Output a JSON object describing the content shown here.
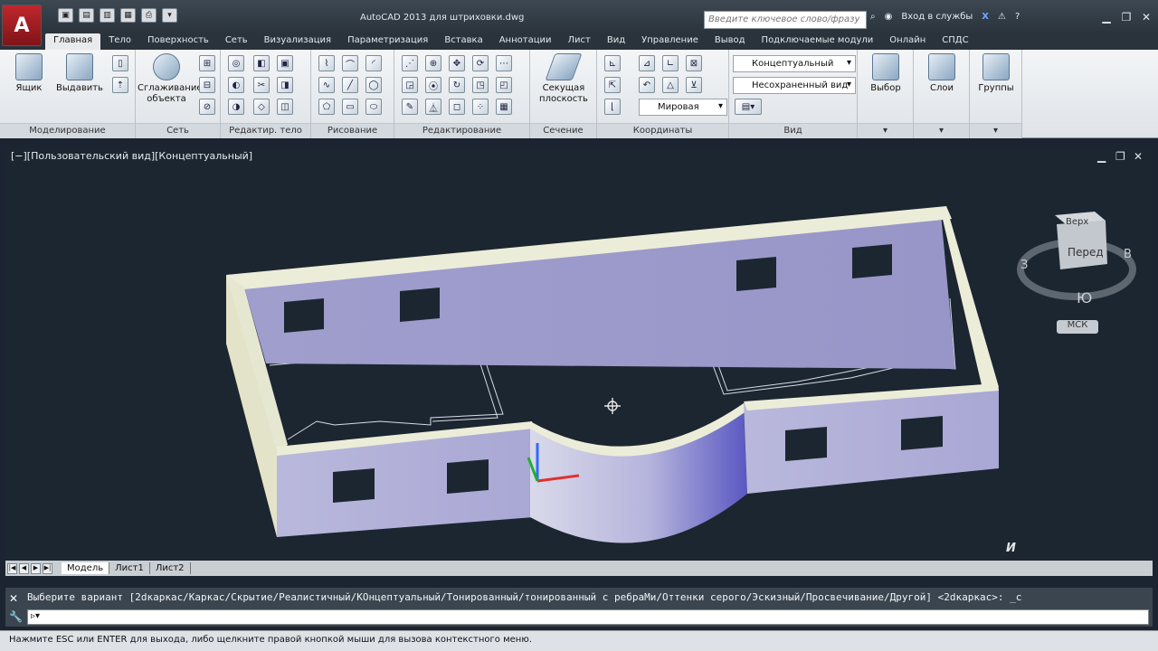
{
  "app": {
    "button_label": "A",
    "window_title": "AutoCAD 2013    для штриховки.dwg",
    "search_placeholder": "Введите ключевое слово/фразу",
    "login_label": "Вход в службы"
  },
  "qat_icons": [
    "save-icon",
    "saveas-icon",
    "open-icon",
    "new-icon",
    "print-icon",
    "more-icon"
  ],
  "tabs": [
    "Главная",
    "Тело",
    "Поверхность",
    "Сеть",
    "Визуализация",
    "Параметризация",
    "Вставка",
    "Аннотации",
    "Лист",
    "Вид",
    "Управление",
    "Вывод",
    "Подключаемые модули",
    "Онлайн",
    "СПДС"
  ],
  "ribbon": {
    "box_label": "Ящик",
    "extrude_label": "Выдавить",
    "smooth_label_1": "Сглаживание",
    "smooth_label_2": "объекта",
    "section_label_1": "Секущая",
    "section_label_2": "плоскость",
    "select_label": "Выбор",
    "layers_label": "Слои",
    "groups_label": "Группы",
    "visual_style": "Концептуальный",
    "named_view": "Несохраненный вид",
    "coords_world": "Мировая",
    "panels": {
      "modeling": "Моделирование",
      "mesh": "Сеть",
      "solid_edit": "Редактир. тело",
      "draw": "Рисование",
      "modify": "Редактирование",
      "section": "Сечение",
      "coordinates": "Координаты",
      "view": "Вид"
    }
  },
  "viewport": {
    "title": "[−][Пользовательский вид][Концептуальный]",
    "viewcube": {
      "top": "Верх",
      "front": "Перед",
      "west": "З",
      "east": "В",
      "south": "Ю",
      "ucs": "МСК"
    }
  },
  "layout_tabs": [
    "Модель",
    "Лист1",
    "Лист2"
  ],
  "command": {
    "history": "Выберите вариант [2dкаркас/Каркас/Скрытие/Реалистичный/КОнцептуальный/Тонированный/тонированный с ребраМи/Оттенки серого/Эскизный/Просвечивание/Другой] <2dкаркас>: _c",
    "prompt": ""
  },
  "status_text": "Нажмите ESC или ENTER для выхода, либо щелкните правой кнопкой мыши для вызова контекстного меню.",
  "colors": {
    "viewport_bg": "#1c2631",
    "wall_face": "#9a98c8",
    "wall_top": "#ecedd8",
    "accent": "#c0272d"
  }
}
